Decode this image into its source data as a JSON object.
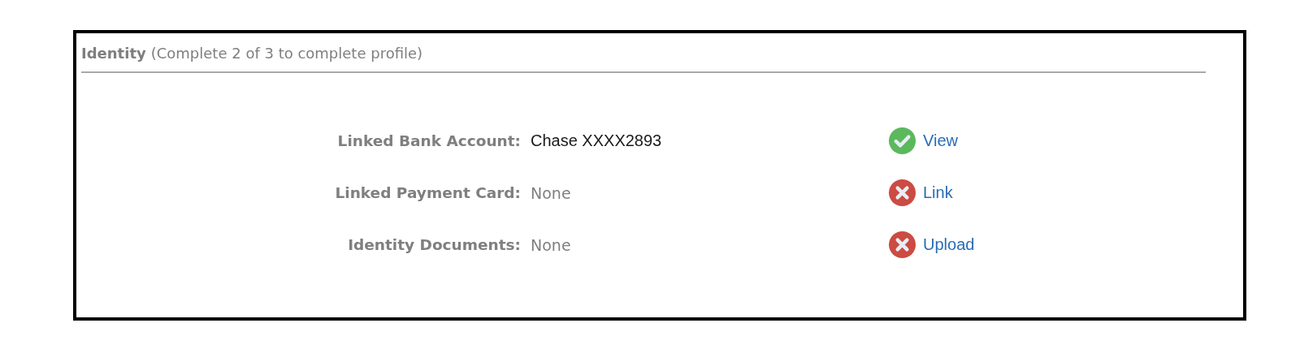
{
  "section": {
    "title": "Identity",
    "subtitle": "(Complete 2 of 3 to complete profile)"
  },
  "rows": [
    {
      "label": "Linked Bank Account:",
      "value": "Chase XXXX2893",
      "linked": true,
      "action": "View"
    },
    {
      "label": "Linked Payment Card:",
      "value": "None",
      "linked": false,
      "action": "Link"
    },
    {
      "label": "Identity Documents:",
      "value": "None",
      "linked": false,
      "action": "Upload"
    }
  ]
}
